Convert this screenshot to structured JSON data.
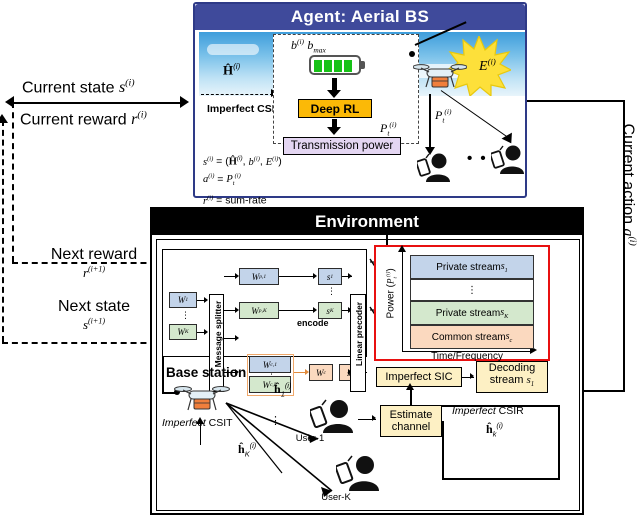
{
  "agent": {
    "title": "Agent: Aerial BS",
    "sky_channel_label": "Ĥ⁽ⁱ⁾",
    "imperfect_csi": "Imperfect CSI",
    "battery_label": "b⁽ⁱ⁾ b_max",
    "deep_rl": "Deep RL",
    "transmission_power": "Transmission power",
    "pt_label": "P_t⁽ⁱ⁾",
    "energy_label": "E⁽ⁱ⁾",
    "pt_down_label": "P_t⁽ⁱ⁾",
    "dots": "• • •",
    "equations": [
      "s⁽ⁱ⁾ = (Ĥ⁽ⁱ⁾, b⁽ⁱ⁾, E⁽ⁱ⁾)",
      "a⁽ⁱ⁾ = P_t⁽ⁱ⁾",
      "r⁽ⁱ⁾ = sum-rate"
    ],
    "battery_cells": 4
  },
  "loop": {
    "current_state": "Current state s⁽ⁱ⁾",
    "current_reward": "Current reward r⁽ⁱ⁾",
    "next_reward": "Next reward r⁽ⁱ⁺¹⁾",
    "next_state": "Next state s⁽ⁱ⁺¹⁾",
    "current_action": "Current action a⁽ⁱ⁾"
  },
  "environment": {
    "title": "Environment",
    "transmitter": {
      "inputs": [
        "W₁",
        "W_K"
      ],
      "message_splitter": "Message splitter",
      "private_streams": [
        "W_p,1",
        "W_p,K"
      ],
      "common_streams": [
        "W_c,1",
        "W_c,K"
      ],
      "combined_common": "W_c",
      "encode_label": "encode",
      "symbols": [
        "s₁",
        "s_K",
        "s_c"
      ],
      "linear_precoder": "Linear precoder",
      "vdots": "⋮"
    },
    "power_chart": {
      "ylabel": "Power (P_t⁽ⁱ⁾)",
      "xlabel": "Time/Frequency",
      "layers": [
        {
          "label": "Private stream s₁",
          "color": "#c3d4ea"
        },
        {
          "label": "⋮",
          "color": "#ffffff"
        },
        {
          "label": "Private stream s_K",
          "color": "#d4e8cd"
        },
        {
          "label": "Common stream s_c",
          "color": "#fbd9bf"
        }
      ],
      "border_color": "#e81010"
    },
    "scene": {
      "base_station": "Base station",
      "imperfect_csit": "Imperfect CSIT",
      "h1": "ĥ₁⁽ⁱ⁾",
      "hk": "ĥ_K⁽ⁱ⁾",
      "user1": "User-1",
      "userk": "User-K",
      "dots": "⋮"
    },
    "receiver": {
      "imperfect_sic": "Imperfect SIC",
      "decoding_stream": "Decoding stream s₁",
      "estimate_channel": "Estimate channel",
      "imperfect_csir": "Imperfect CSIR",
      "hk_feedback": "ĥ_k⁽ⁱ⁾"
    }
  },
  "colors": {
    "agent_header": "#3f4a9b",
    "env_header": "#000000",
    "deep_rl": "#fbb907",
    "tx_power": "#e4d6f2",
    "process_box": "#fdf0c4",
    "private_blue": "#c3d4ea",
    "private_green": "#d4e8cd",
    "common_orange": "#fbd9bf",
    "chart_border": "#e81010",
    "battery_fill": "#17c217"
  }
}
